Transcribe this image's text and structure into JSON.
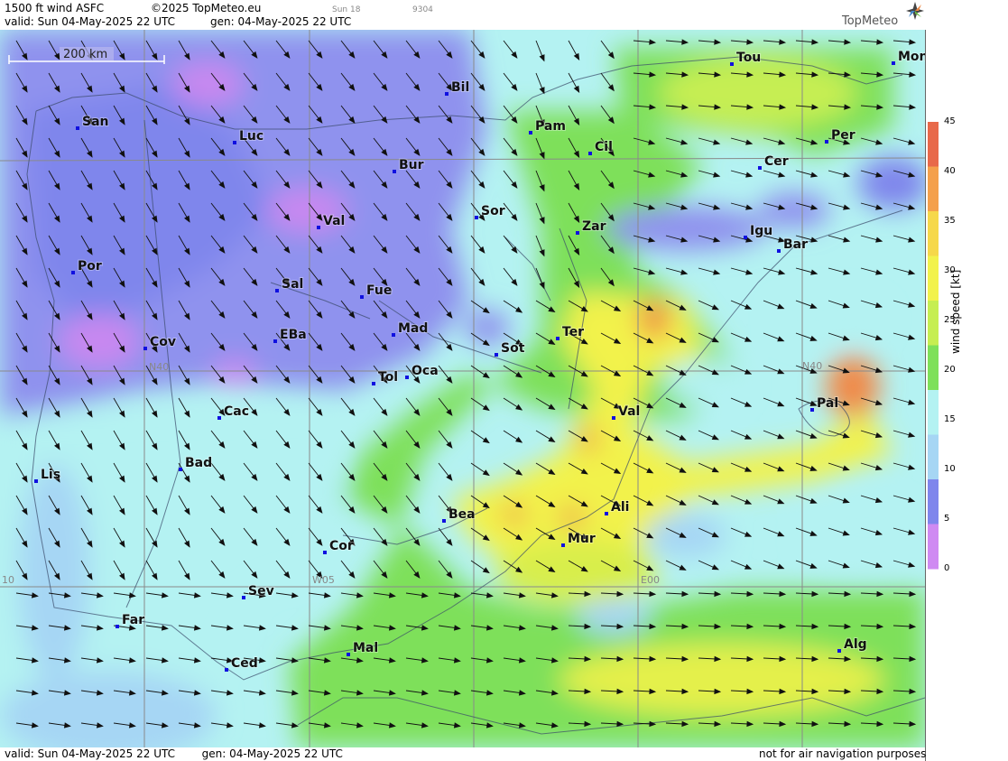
{
  "header": {
    "product": "1500 ft wind ASFC",
    "copyright": "©2025 TopMeteo.eu",
    "run_code": "Sun 18",
    "id_code": "9304",
    "valid_line": "valid:  Sun  04-May-2025  22 UTC",
    "gen_line": "gen: 04-May-2025 22 UTC"
  },
  "logo": {
    "text": "TopMeteo",
    "icon": "compass-star-icon"
  },
  "scale_bar": {
    "label": "200 km"
  },
  "grid_labels": {
    "lat_west": "N40",
    "lat_east": "N40",
    "lon_w05": "W05",
    "lon_e00": "E00",
    "lon_w10": "10"
  },
  "cities": [
    {
      "name": "San"
    },
    {
      "name": "Luc"
    },
    {
      "name": "Bil"
    },
    {
      "name": "Pam"
    },
    {
      "name": "Cil"
    },
    {
      "name": "Tou"
    },
    {
      "name": "Mon"
    },
    {
      "name": "Per"
    },
    {
      "name": "Cer"
    },
    {
      "name": "Bur"
    },
    {
      "name": "Sor"
    },
    {
      "name": "Val"
    },
    {
      "name": "Zar"
    },
    {
      "name": "Igu"
    },
    {
      "name": "Bar"
    },
    {
      "name": "Por"
    },
    {
      "name": "Sal"
    },
    {
      "name": "Fue"
    },
    {
      "name": "Mad"
    },
    {
      "name": "Ter"
    },
    {
      "name": "Cov"
    },
    {
      "name": "EBa"
    },
    {
      "name": "Sot"
    },
    {
      "name": "Tol"
    },
    {
      "name": "Oca"
    },
    {
      "name": "Pal"
    },
    {
      "name": "Cac"
    },
    {
      "name": "Val"
    },
    {
      "name": "Bad"
    },
    {
      "name": "Lis"
    },
    {
      "name": "Bea"
    },
    {
      "name": "Ali"
    },
    {
      "name": "Mur"
    },
    {
      "name": "Cor"
    },
    {
      "name": "Sev"
    },
    {
      "name": "Far"
    },
    {
      "name": "Mal"
    },
    {
      "name": "Alg"
    },
    {
      "name": "Ced"
    }
  ],
  "legend": {
    "title": "wind speed [kt]",
    "ticks": [
      "45",
      "40",
      "35",
      "30",
      "25",
      "20",
      "15",
      "10",
      "5",
      "0"
    ],
    "colors": [
      "#e8694a",
      "#f4a04c",
      "#f6d84a",
      "#f2f24c",
      "#c6ee52",
      "#7ee05a",
      "#b4f2f2",
      "#a6d6f4",
      "#7f86ec",
      "#cf8af2"
    ]
  },
  "footer": {
    "valid_line": "valid:  Sun  04-May-2025  22 UTC",
    "gen_line": "gen: 04-May-2025 22 UTC",
    "disclaimer": "not for air navigation purposes"
  }
}
